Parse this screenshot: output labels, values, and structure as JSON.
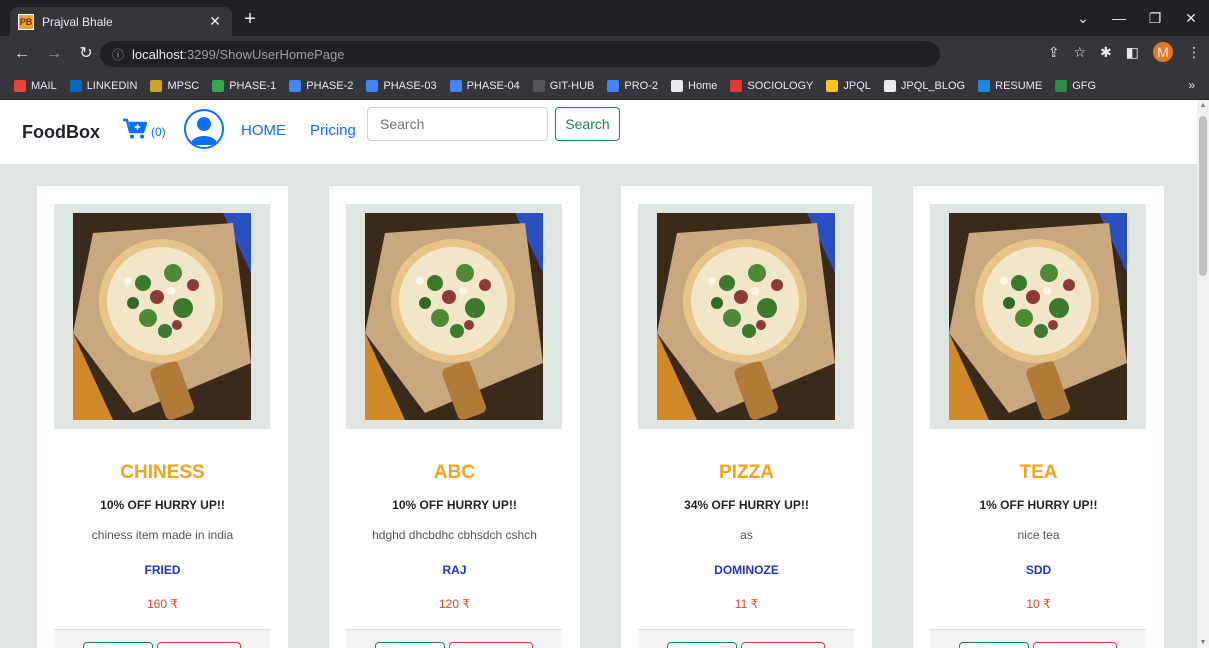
{
  "browser": {
    "tab_title": "Prajval Bhale",
    "tab_favicon": "PB",
    "url_host": "localhost",
    "url_rest": ":3299/ShowUserHomePage",
    "profile_initial": "M",
    "bookmarks": [
      {
        "label": "MAIL",
        "color": "#ea4335"
      },
      {
        "label": "LINKEDIN",
        "color": "#0a66c2"
      },
      {
        "label": "MPSC",
        "color": "#c9a227"
      },
      {
        "label": "PHASE-1",
        "color": "#34a853"
      },
      {
        "label": "PHASE-2",
        "color": "#4285f4"
      },
      {
        "label": "PHASE-03",
        "color": "#4285f4"
      },
      {
        "label": "PHASE-04",
        "color": "#4285f4"
      },
      {
        "label": "GIT-HUB",
        "color": "#555555"
      },
      {
        "label": "PRO-2",
        "color": "#4285f4"
      },
      {
        "label": "Home",
        "color": "#e8eaed"
      },
      {
        "label": "SOCIOLOGY",
        "color": "#e53935"
      },
      {
        "label": "JPQL",
        "color": "#f5c518"
      },
      {
        "label": "JPQL_BLOG",
        "color": "#e8eaed"
      },
      {
        "label": "RESUME",
        "color": "#1e88e5"
      },
      {
        "label": "GFG",
        "color": "#2f8d46"
      }
    ]
  },
  "navbar": {
    "brand": "FoodBox",
    "cart_count": "(0)",
    "links": [
      "HOME",
      "Pricing"
    ],
    "search_placeholder": "Search",
    "search_button": "Search"
  },
  "colors": {
    "title": "#f5a31a",
    "vendor": "#2533c9",
    "price": "#e0452b"
  },
  "cards": [
    {
      "title": "CHINESS",
      "offer": "10% OFF HURRY UP!!",
      "desc": "chiness item made in india",
      "vendor": "FRIED",
      "price": "160 ₹"
    },
    {
      "title": "ABC",
      "offer": "10% OFF HURRY UP!!",
      "desc": "hdghd dhcbdhc cbhsdch cshch",
      "vendor": "RAJ",
      "price": "120 ₹"
    },
    {
      "title": "PIZZA",
      "offer": "34% OFF HURRY UP!!",
      "desc": "as",
      "vendor": "DOMINOZE",
      "price": "11 ₹"
    },
    {
      "title": "TEA",
      "offer": "1% OFF HURRY UP!!",
      "desc": "nice tea",
      "vendor": "SDD",
      "price": "10 ₹"
    }
  ]
}
